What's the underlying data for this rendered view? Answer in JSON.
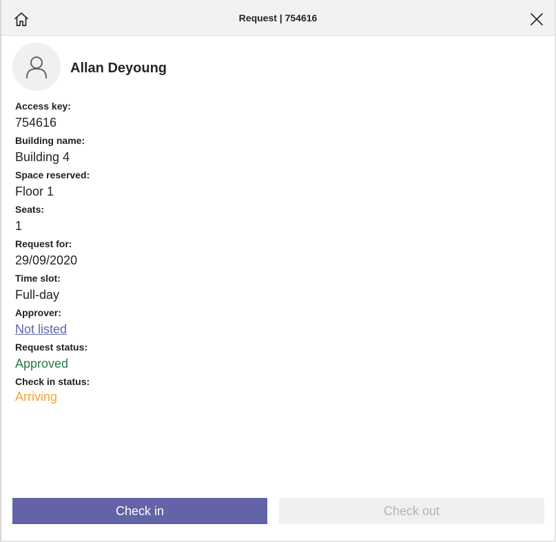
{
  "titlebar": {
    "title": "Request | 754616",
    "home_icon": "home-icon",
    "close_icon": "close-icon"
  },
  "profile": {
    "name": "Allan Deyoung",
    "avatar_icon": "person-icon"
  },
  "fields": {
    "access_key": {
      "label": "Access key:",
      "value": "754616"
    },
    "building_name": {
      "label": "Building name:",
      "value": "Building 4"
    },
    "space_reserved": {
      "label": "Space reserved:",
      "value": "Floor 1"
    },
    "seats": {
      "label": "Seats:",
      "value": "1"
    },
    "request_for": {
      "label": "Request for:",
      "value": "29/09/2020"
    },
    "time_slot": {
      "label": "Time slot:",
      "value": "Full-day"
    },
    "approver": {
      "label": "Approver:",
      "value": "Not listed"
    },
    "request_status": {
      "label": "Request status:",
      "value": "Approved"
    },
    "check_in_status": {
      "label": "Check in status:",
      "value": "Arriving"
    }
  },
  "actions": {
    "check_in_label": "Check in",
    "check_out_label": "Check out"
  },
  "colors": {
    "accent": "#6264a7",
    "approved": "#237b4b",
    "arriving": "#f2a533",
    "disabled_bg": "#f0f0f0",
    "disabled_text": "#b3b3b3"
  }
}
